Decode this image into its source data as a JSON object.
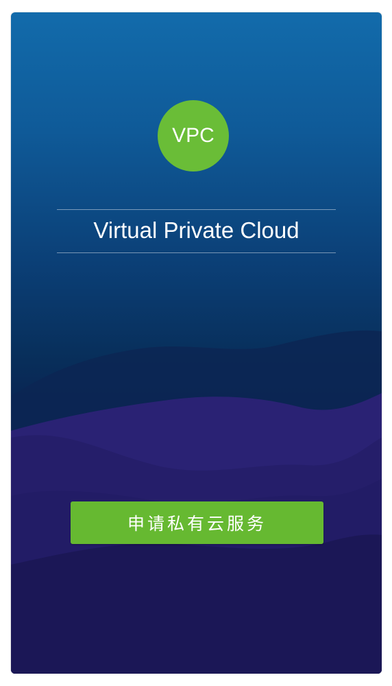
{
  "app": {
    "logo_text": "VPC",
    "title": "Virtual Private Cloud",
    "apply_button_label": "申请私有云服务"
  },
  "colors": {
    "accent_green": "#6abd37",
    "background_top": "#126bab",
    "background_bottom": "#1a1550"
  }
}
